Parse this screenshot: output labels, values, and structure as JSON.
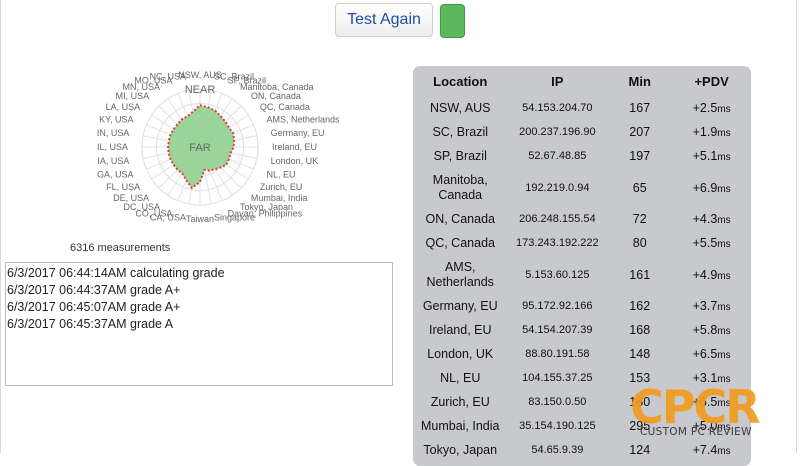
{
  "toolbar": {
    "test_again_label": "Test Again",
    "status_color": "#5cb85c"
  },
  "radar": {
    "near_label": "NEAR",
    "far_label": "FAR",
    "fill_color": "#8fd08f",
    "outline_color": "#e53935",
    "spokes": [
      {
        "label": "NSW, AUS",
        "value": 0.72
      },
      {
        "label": "SC, Brazil",
        "value": 0.7
      },
      {
        "label": "SP, Brazil",
        "value": 0.68
      },
      {
        "label": "Manitoba, Canada",
        "value": 0.64
      },
      {
        "label": "ON, Canada",
        "value": 0.62
      },
      {
        "label": "QC, Canada",
        "value": 0.6
      },
      {
        "label": "AMS, Netherlands",
        "value": 0.62
      },
      {
        "label": "Germany, EU",
        "value": 0.6
      },
      {
        "label": "Ireland, EU",
        "value": 0.58
      },
      {
        "label": "London, UK",
        "value": 0.54
      },
      {
        "label": "NL, EU",
        "value": 0.54
      },
      {
        "label": "Zurich, EU",
        "value": 0.55
      },
      {
        "label": "Mumbai, India",
        "value": 0.5
      },
      {
        "label": "Tokyo, Japan",
        "value": 0.46
      },
      {
        "label": "Davao, Philippines",
        "value": 0.44
      },
      {
        "label": "Singapore",
        "value": 0.4
      },
      {
        "label": "Taiwan",
        "value": 0.6
      },
      {
        "label": "CA, USA",
        "value": 0.72
      },
      {
        "label": "CO, USA",
        "value": 0.62
      },
      {
        "label": "DC, USA",
        "value": 0.55
      },
      {
        "label": "DE, USA",
        "value": 0.55
      },
      {
        "label": "FL, USA",
        "value": 0.55
      },
      {
        "label": "GA, USA",
        "value": 0.55
      },
      {
        "label": "IA, USA",
        "value": 0.55
      },
      {
        "label": "IL, USA",
        "value": 0.55
      },
      {
        "label": "IN, USA",
        "value": 0.55
      },
      {
        "label": "KY, USA",
        "value": 0.55
      },
      {
        "label": "LA, USA",
        "value": 0.55
      },
      {
        "label": "MI, USA",
        "value": 0.55
      },
      {
        "label": "MN, USA",
        "value": 0.57
      },
      {
        "label": "MO, USA",
        "value": 0.57
      },
      {
        "label": "NC, USA",
        "value": 0.62
      }
    ]
  },
  "measurements_text": "6316 measurements",
  "log": [
    "6/3/2017 06:44:14AM calculating grade",
    "6/3/2017 06:44:37AM grade A+",
    "6/3/2017 06:45:07AM grade A+",
    "6/3/2017 06:45:37AM grade A"
  ],
  "table": {
    "headers": {
      "location": "Location",
      "ip": "IP",
      "min": "Min",
      "pdv": "+PDV"
    },
    "unit": "ms",
    "rows": [
      {
        "location": "NSW, AUS",
        "ip": "54.153.204.70",
        "min": "167",
        "pdv": "+2.5"
      },
      {
        "location": "SC, Brazil",
        "ip": "200.237.196.90",
        "min": "207",
        "pdv": "+1.9"
      },
      {
        "location": "SP, Brazil",
        "ip": "52.67.48.85",
        "min": "197",
        "pdv": "+5.1"
      },
      {
        "location": "Manitoba, Canada",
        "ip": "192.219.0.94",
        "min": "65",
        "pdv": "+6.9"
      },
      {
        "location": "ON, Canada",
        "ip": "206.248.155.54",
        "min": "72",
        "pdv": "+4.3"
      },
      {
        "location": "QC, Canada",
        "ip": "173.243.192.222",
        "min": "80",
        "pdv": "+5.5"
      },
      {
        "location": "AMS, Netherlands",
        "ip": "5.153.60.125",
        "min": "161",
        "pdv": "+4.9"
      },
      {
        "location": "Germany, EU",
        "ip": "95.172.92.166",
        "min": "162",
        "pdv": "+3.7"
      },
      {
        "location": "Ireland, EU",
        "ip": "54.154.207.39",
        "min": "168",
        "pdv": "+5.8"
      },
      {
        "location": "London, UK",
        "ip": "88.80.191.58",
        "min": "148",
        "pdv": "+6.5"
      },
      {
        "location": "NL, EU",
        "ip": "104.155.37.25",
        "min": "153",
        "pdv": "+3.1"
      },
      {
        "location": "Zurich, EU",
        "ip": "83.150.0.50",
        "min": "180",
        "pdv": "+6.5"
      },
      {
        "location": "Mumbai, India",
        "ip": "35.154.190.125",
        "min": "295",
        "pdv": "+5.0"
      },
      {
        "location": "Tokyo, Japan",
        "ip": "54.65.9.39",
        "min": "124",
        "pdv": "+7.4"
      }
    ]
  },
  "watermark": {
    "logo": "CPCR",
    "text": "CUSTOM PC REVIEW",
    "color": "#f29b1d"
  }
}
